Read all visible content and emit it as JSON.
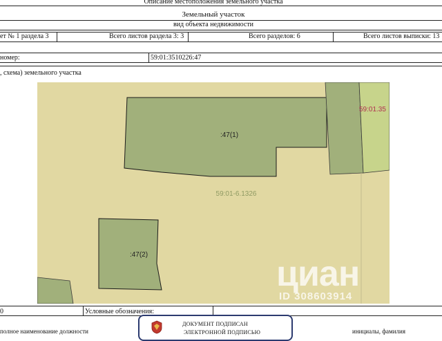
{
  "header": {
    "title_top": "Описание местоположения земельного участка",
    "object_type": "Земельный участок",
    "object_kind_caption": "вид объекта недвижимости"
  },
  "sheet_row": {
    "sheet_no": "ет № 1 раздела 3",
    "section_sheets": "Всего листов раздела 3: 3",
    "sections_total": "Всего разделов: 6",
    "extract_sheets": "Всего листов выписки: 13"
  },
  "cadastral_row": {
    "label": "номер:",
    "value": "59:01:3510226:47"
  },
  "plan_caption": ", схема) земельного участка",
  "map": {
    "parcel_main": ":47(1)",
    "parcel_secondary": ":47(2)",
    "block_number": "59:01-6.1326",
    "neighbor_number": "59:01.35",
    "colors": {
      "background": "#e1d8a2",
      "parcel_fill": "#a1b07b",
      "neighbor_fill": "#c7d48b",
      "label_red": "#b03050"
    }
  },
  "footer": {
    "scale_fragment": "0",
    "legend_label": "Условные обозначения:",
    "signature_line1": "ДОКУМЕНТ ПОДПИСАН",
    "signature_line2": "ЭЛЕКТРОННОЙ ПОДПИСЬЮ",
    "bottom_left": "полное наименование должности",
    "bottom_right": "инициалы, фамилия"
  },
  "watermark": {
    "brand": "циан",
    "id_text": "ID 308603914"
  }
}
